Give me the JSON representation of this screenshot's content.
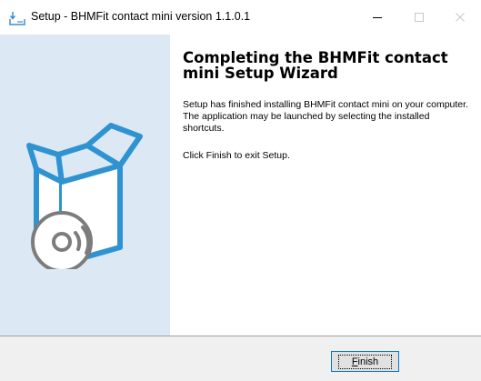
{
  "window": {
    "title": "Setup - BHMFit contact mini version 1.1.0.1"
  },
  "content": {
    "heading": "Completing the BHMFit contact mini Setup Wizard",
    "paragraph1": "Setup has finished installing BHMFit contact mini on your computer. The application may be launched by selecting the installed shortcuts.",
    "paragraph2": "Click Finish to exit Setup."
  },
  "buttons": {
    "finish_accel": "F",
    "finish_rest": "inish"
  },
  "icons": {
    "app": "setup-install-icon",
    "minimize": "minimize-icon",
    "maximize": "maximize-icon",
    "close": "close-icon",
    "artwork": "open-box-with-disc-icon"
  },
  "colors": {
    "left_panel": "#dce9f5",
    "artwork_blue": "#2f93d2",
    "focus_border": "#0078d7"
  }
}
